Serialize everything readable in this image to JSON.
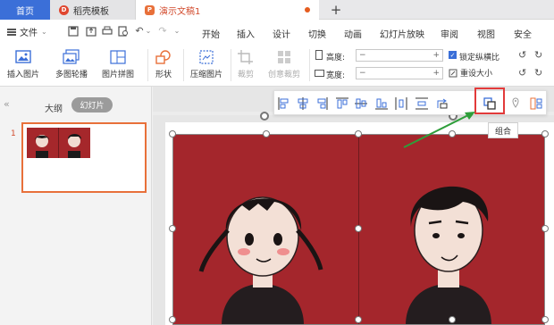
{
  "tabs": {
    "home": "首页",
    "template": "稻壳模板",
    "document": "演示文稿1",
    "add": "+"
  },
  "menu": {
    "file": "文件",
    "items": [
      "开始",
      "插入",
      "设计",
      "切换",
      "动画",
      "幻灯片放映",
      "审阅",
      "视图",
      "安全"
    ]
  },
  "ribbon": {
    "insert_picture": "插入图片",
    "multi_outline": "多图轮播",
    "picture_collage": "图片拼图",
    "shape": "形状",
    "compress_picture": "压缩图片",
    "crop": "裁剪",
    "creative_crop": "创意裁剪",
    "height_label": "高度:",
    "width_label": "宽度:",
    "lock_ratio": "锁定纵横比",
    "reset_size": "重设大小",
    "minus": "−",
    "plus": "+"
  },
  "left_panel": {
    "outline_tab": "大纲",
    "slides_tab": "幻灯片",
    "slide_number": "1"
  },
  "tooltip": {
    "group": "组合"
  },
  "colors": {
    "accent_blue": "#3b6fd8",
    "doc_orange": "#e8703a",
    "photo_red": "#a4262c",
    "highlight_red": "#e23a3a",
    "arrow_green": "#2e9e3a"
  }
}
